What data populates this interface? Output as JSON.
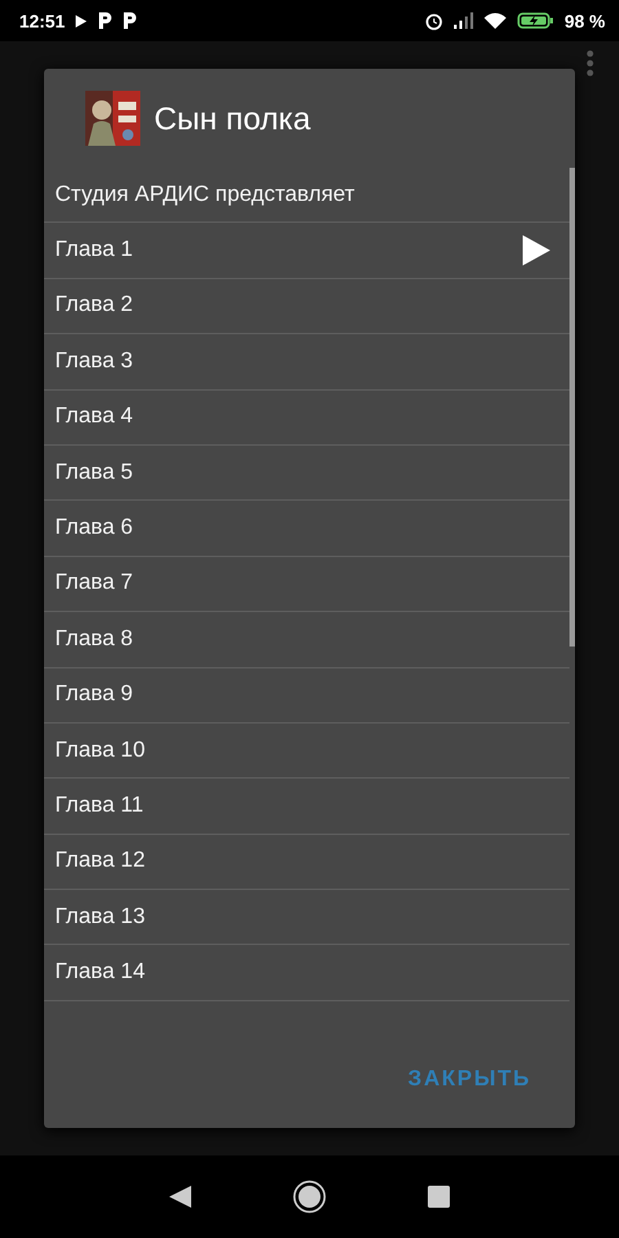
{
  "status_bar": {
    "time": "12:51",
    "battery": "98 %"
  },
  "dialog": {
    "title": "Сын полка",
    "items": [
      {
        "label": "Студия АРДИС представляет",
        "playing": false
      },
      {
        "label": "Глава 1",
        "playing": true
      },
      {
        "label": "Глава 2",
        "playing": false
      },
      {
        "label": "Глава 3",
        "playing": false
      },
      {
        "label": "Глава 4",
        "playing": false
      },
      {
        "label": "Глава 5",
        "playing": false
      },
      {
        "label": "Глава 6",
        "playing": false
      },
      {
        "label": "Глава 7",
        "playing": false
      },
      {
        "label": "Глава 8",
        "playing": false
      },
      {
        "label": "Глава 9",
        "playing": false
      },
      {
        "label": "Глава 10",
        "playing": false
      },
      {
        "label": "Глава 11",
        "playing": false
      },
      {
        "label": "Глава 12",
        "playing": false
      },
      {
        "label": "Глава 13",
        "playing": false
      },
      {
        "label": "Глава 14",
        "playing": false
      }
    ],
    "close_button": "ЗАКРЫТЬ"
  }
}
